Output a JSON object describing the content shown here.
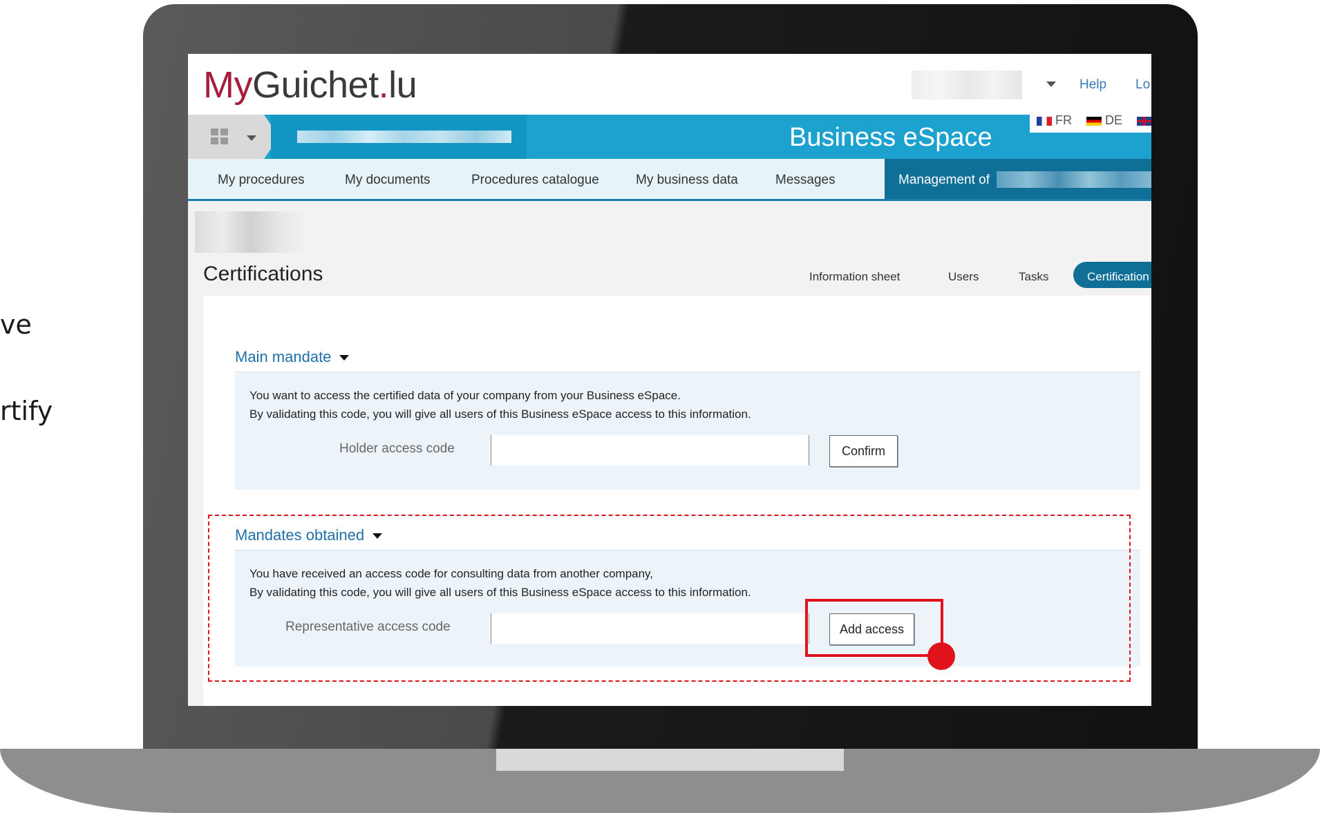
{
  "side_fragments": [
    "ve",
    "rtify"
  ],
  "app": {
    "logo_prefix": "My",
    "logo_main": "Guichet",
    "logo_dot": ".",
    "logo_suffix": "lu",
    "help_label": "Help",
    "logout_label": "Lo",
    "languages": [
      "FR",
      "DE"
    ],
    "banner_title": "Business eSpace"
  },
  "nav": {
    "items": [
      "My procedures",
      "My documents",
      "Procedures catalogue",
      "My business data",
      "Messages"
    ],
    "active_label": "Management of"
  },
  "page": {
    "title": "Certifications",
    "subtabs": [
      "Information sheet",
      "Users",
      "Tasks"
    ],
    "active_subtab": "Certification"
  },
  "main_mandate": {
    "heading": "Main mandate",
    "line1": "You want to access the certified data of your company from your Business eSpace.",
    "line2": "By validating this code, you will give all users of this Business eSpace access to this information.",
    "field_label": "Holder access code",
    "field_value": "",
    "button_label": "Confirm"
  },
  "mandates_obtained": {
    "heading": "Mandates obtained",
    "line1": "You have received an access code for consulting data from another company,",
    "line2": "By validating this code, you will give all users of this Business eSpace access to this information.",
    "field_label": "Representative access code",
    "field_value": "",
    "button_label": "Add access"
  },
  "colors": {
    "brand_red": "#a51f3c",
    "banner_blue": "#1da1cf",
    "active_nav": "#0f6f96",
    "link_blue": "#1f6fa8",
    "annotation_red": "#e0121b"
  }
}
